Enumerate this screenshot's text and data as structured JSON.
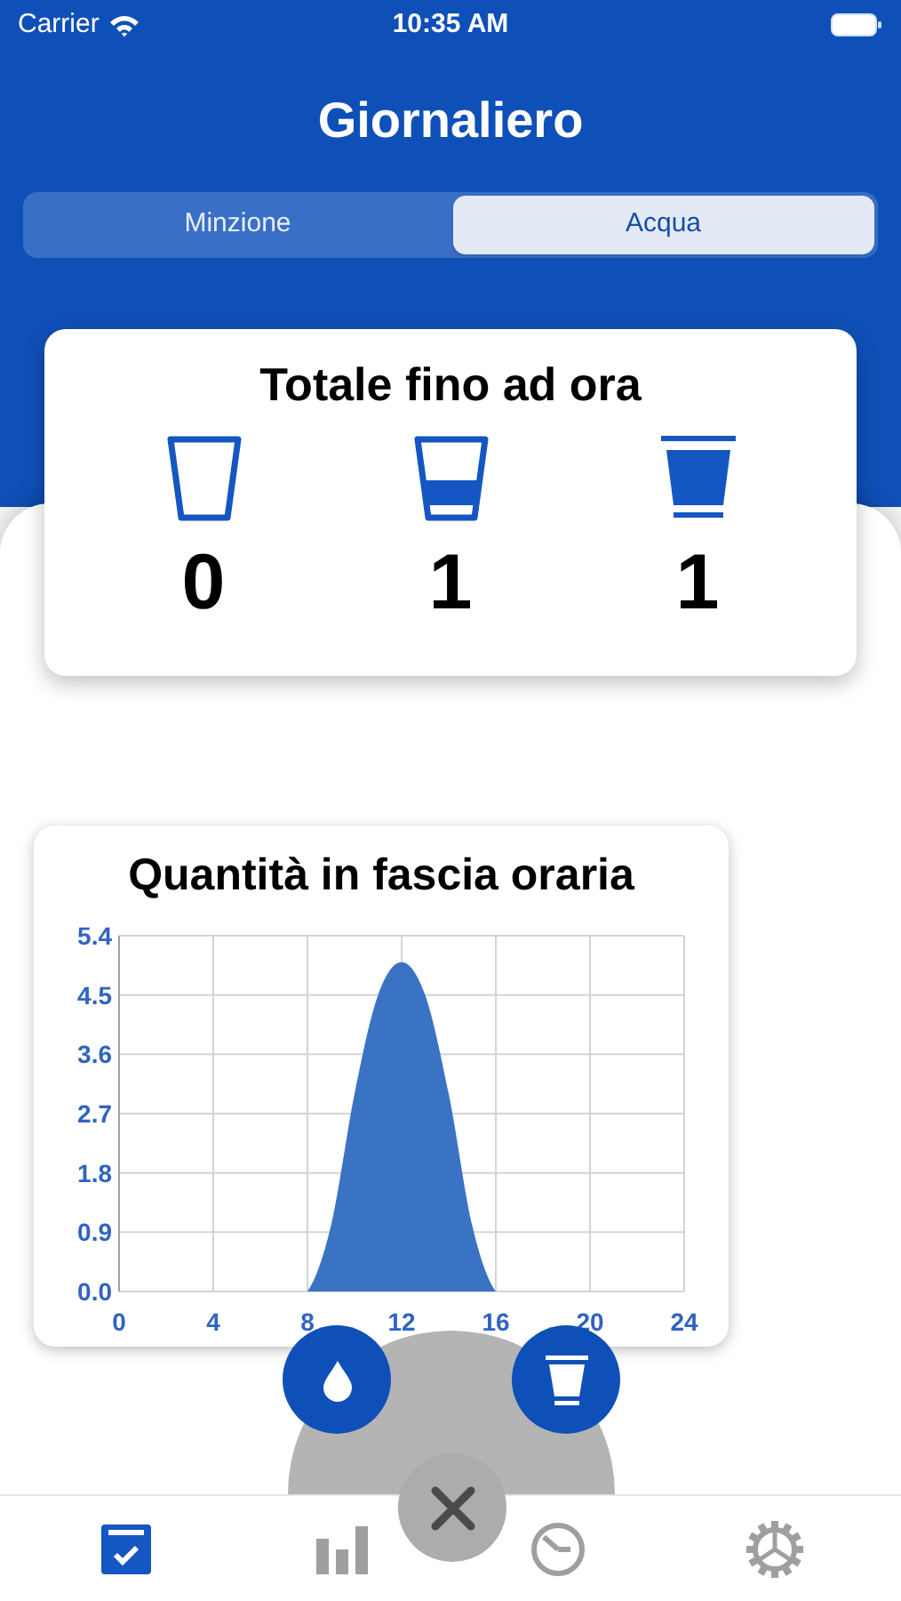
{
  "status_bar": {
    "carrier": "Carrier",
    "time": "10:35 AM"
  },
  "title": "Giornaliero",
  "segments": [
    {
      "label": "Minzione",
      "selected": false
    },
    {
      "label": "Acqua",
      "selected": true
    }
  ],
  "totals": {
    "title": "Totale fino ad ora",
    "items": [
      {
        "kind": "empty",
        "count": "0"
      },
      {
        "kind": "half",
        "count": "1"
      },
      {
        "kind": "full",
        "count": "1"
      }
    ]
  },
  "hourly": {
    "title": "Quantità in fascia oraria",
    "chart_data": {
      "type": "area",
      "x": [
        0,
        1,
        2,
        3,
        4,
        5,
        6,
        7,
        8,
        9,
        10,
        11,
        12,
        13,
        14,
        15,
        16,
        17,
        18,
        19,
        20,
        21,
        22,
        23,
        24
      ],
      "grid": true,
      "series": [
        {
          "color": "#3a73c4",
          "values": [
            0,
            0,
            0,
            0,
            0,
            0,
            0,
            0,
            0,
            1.0,
            3.0,
            4.5,
            5.0,
            4.5,
            3.0,
            1.0,
            0,
            0,
            0,
            0,
            0,
            0,
            0,
            0,
            0
          ]
        }
      ],
      "xlim": [
        0,
        24
      ],
      "ylim": [
        0,
        5.4
      ],
      "xticks": [
        0,
        4,
        8,
        12,
        16,
        20,
        24
      ],
      "yticks": [
        {
          "value": 0,
          "label": "0.0"
        },
        {
          "value": 0.9,
          "label": "0.9"
        },
        {
          "value": 1.8,
          "label": "1.8"
        },
        {
          "value": 2.7,
          "label": "2.7"
        },
        {
          "value": 3.6,
          "label": "3.6"
        },
        {
          "value": 4.5,
          "label": "4.5"
        },
        {
          "value": 5.4,
          "label": "5.4"
        }
      ]
    }
  },
  "fab_menu": {
    "expanded": true
  },
  "tab_bar": [
    {
      "kind": "diary",
      "selected": true
    },
    {
      "kind": "stats",
      "selected": false
    },
    {
      "kind": "reminders",
      "selected": false
    },
    {
      "kind": "settings",
      "selected": false
    }
  ]
}
